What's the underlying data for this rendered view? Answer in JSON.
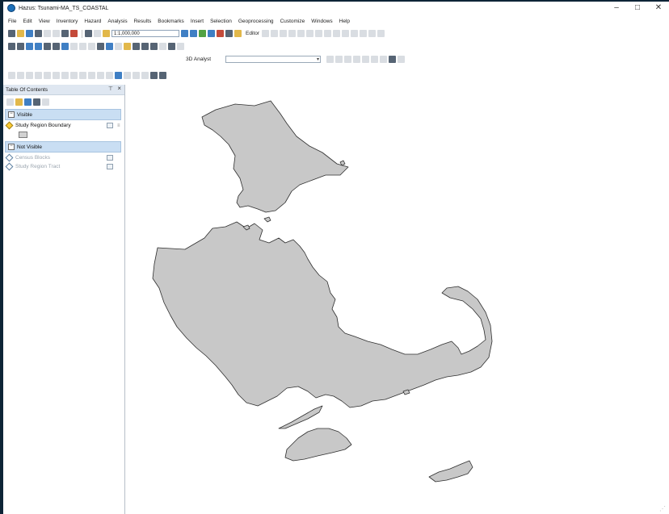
{
  "window": {
    "title": "Hazus: Tsunami-MA_TS_COASTAL",
    "controls": {
      "minimize": "–",
      "maximize": "□",
      "close": "✕"
    }
  },
  "menu": [
    "File",
    "Edit",
    "View",
    "Inventory",
    "Hazard",
    "Analysis",
    "Results",
    "Bookmarks",
    "Insert",
    "Selection",
    "Geoprocessing",
    "Customize",
    "Windows",
    "Help"
  ],
  "toolbar": {
    "scale_value": "1:1,000,000",
    "editor_label": "Editor",
    "analyst_label": "3D Analyst"
  },
  "toc": {
    "title": "Table Of Contents",
    "groups": [
      {
        "label": "Visible",
        "layers": [
          {
            "name": "Study Region Boundary",
            "visible": true
          }
        ]
      },
      {
        "label": "Not Visible",
        "layers": [
          {
            "name": "Census Blocks",
            "visible": false
          },
          {
            "name": "Study Region Tract",
            "visible": false
          }
        ]
      }
    ]
  },
  "map": {
    "fill_color": "#c8c8c8",
    "stroke_color": "#2e2e2e",
    "background": "#ffffff"
  },
  "icons": [
    "app-icon",
    "pin-icon",
    "close-icon",
    "collapse-icon",
    "layer-visible-icon",
    "layer-hidden-icon",
    "source-icon",
    "legend-swatch",
    "pointer-icon",
    "identify-icon",
    "zoom-in-icon",
    "zoom-out-icon",
    "pan-icon",
    "full-extent-icon",
    "save-icon",
    "open-icon",
    "new-icon",
    "print-icon",
    "undo-icon",
    "redo-icon",
    "add-data-icon"
  ]
}
